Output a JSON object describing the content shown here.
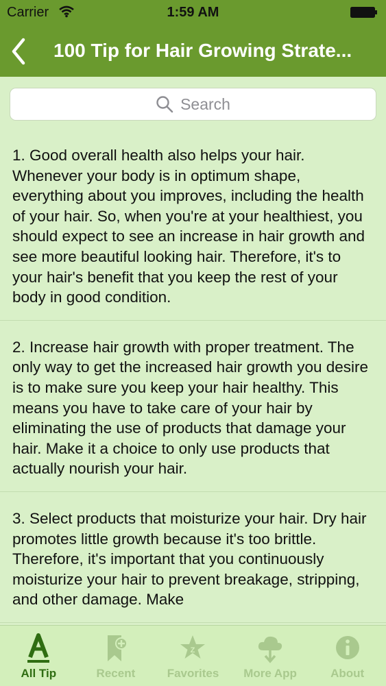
{
  "status_bar": {
    "carrier": "Carrier",
    "time": "1:59 AM"
  },
  "nav": {
    "title": "100 Tip for Hair Growing Strate..."
  },
  "search": {
    "placeholder": "Search"
  },
  "tips": [
    {
      "text": "1. Good overall health also helps your hair. Whenever your body is in optimum shape, everything about you improves, including the health of your hair. So, when you're at your healthiest, you should expect to see an increase in hair growth and see more beautiful looking hair. Therefore, it's to your hair's benefit that you keep the rest of your body in good condition."
    },
    {
      "text": "2. Increase hair growth with proper treatment. The only way to get the increased hair growth you desire is to make sure you keep your hair healthy. This means you have to take care of your hair by eliminating the use of products that damage your hair. Make it a choice to only use products that actually nourish your hair."
    },
    {
      "text": "3. Select products that moisturize your hair. Dry hair promotes little growth because it's too brittle. Therefore, it's important that you continuously moisturize your hair to  prevent breakage, stripping, and other damage.  Make"
    }
  ],
  "tabs": [
    {
      "label": "All Tip",
      "icon": "letter-a-icon",
      "active": true
    },
    {
      "label": "Recent",
      "icon": "bookmark-plus-icon",
      "active": false
    },
    {
      "label": "Favorites",
      "icon": "star-icon",
      "active": false
    },
    {
      "label": "More App",
      "icon": "cloud-download-icon",
      "active": false
    },
    {
      "label": "About",
      "icon": "info-icon",
      "active": false
    }
  ],
  "colors": {
    "nav_bar": "#6a9a2e",
    "background": "#d9f0c8",
    "tab_active": "#2f6d12",
    "tab_inactive": "#a9c98e"
  }
}
